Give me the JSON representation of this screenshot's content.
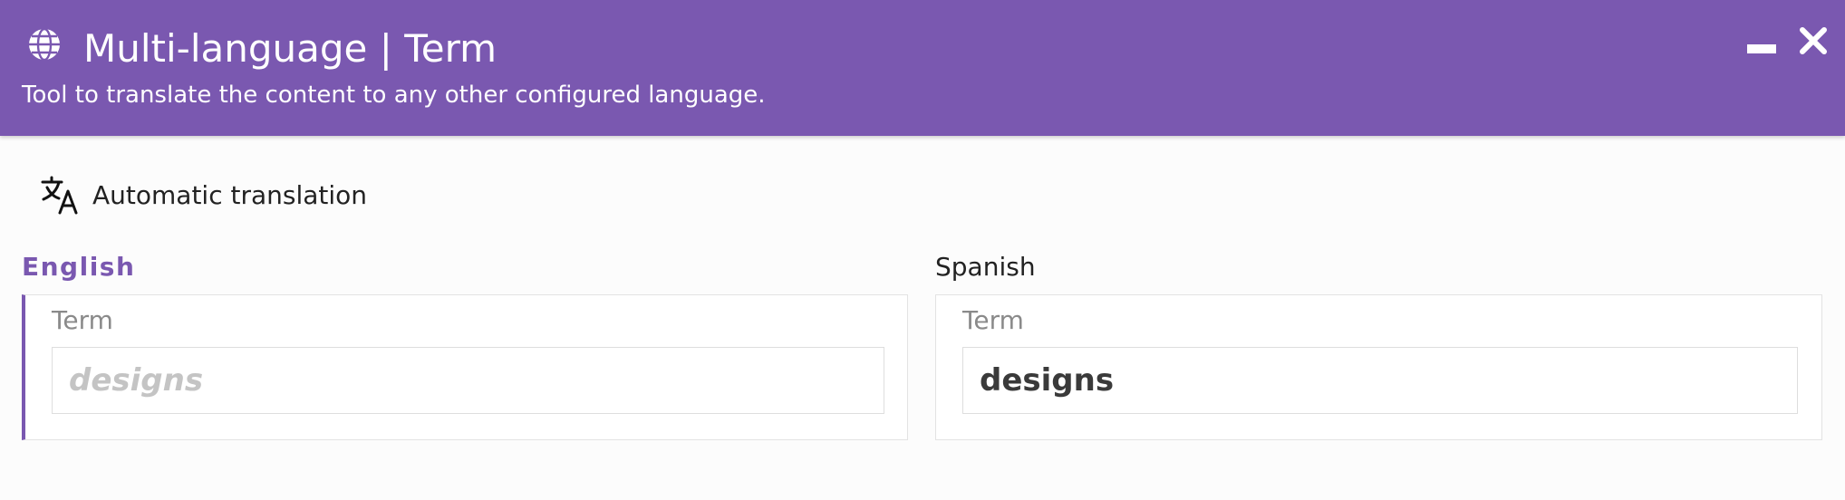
{
  "header": {
    "title": "Multi-language | Term",
    "subtitle": "Tool to translate the content to any other configured language.",
    "icon": "globe-icon",
    "color": "#7a58b0"
  },
  "toolbar": {
    "auto_translate_label": "Automatic translation",
    "auto_translate_icon": "translate-icon"
  },
  "languages": [
    {
      "name": "English",
      "active": true,
      "field_label": "Term",
      "field_value": "designs"
    },
    {
      "name": "Spanish",
      "active": false,
      "field_label": "Term",
      "field_value": "designs"
    }
  ]
}
